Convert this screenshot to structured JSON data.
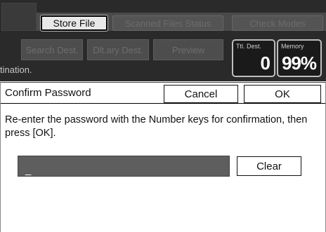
{
  "top": {
    "tabs": [
      {
        "label": "Store File",
        "active": true
      },
      {
        "label": "Scanned Files Status",
        "active": false
      },
      {
        "label": "Check Modes",
        "active": false
      }
    ],
    "row2": [
      {
        "label": "Search Dest."
      },
      {
        "label": "Dlt.ary Dest."
      },
      {
        "label": "Preview"
      }
    ],
    "dest_text": "tination.",
    "counters": [
      {
        "caption": "Ttl. Dest.",
        "value": "0"
      },
      {
        "caption": "Memory",
        "value": "99%"
      }
    ]
  },
  "dialog": {
    "title": "Confirm Password",
    "cancel_label": "Cancel",
    "ok_label": "OK",
    "message": "Re-enter the password with the Number keys for confirmation, then press [OK].",
    "input_value": "_",
    "clear_label": "Clear"
  },
  "colors": {
    "background_dark": "#2a2a2a",
    "dialog_bg": "#ffffff",
    "input_bg": "#5e5e5e"
  }
}
